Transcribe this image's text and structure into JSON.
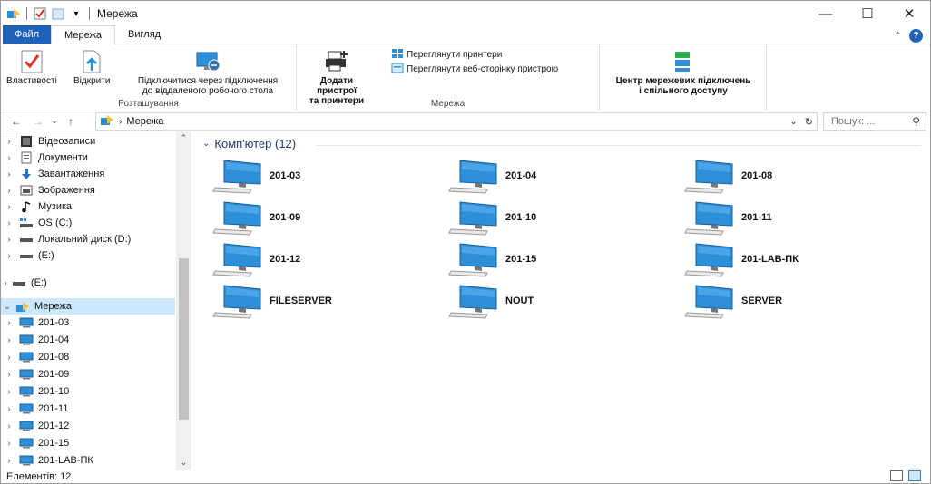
{
  "window": {
    "title": "Мережа",
    "controls": {
      "minimize": "—",
      "maximize": "☐",
      "close": "✕"
    }
  },
  "tabs": [
    "Файл",
    "Мережа",
    "Вигляд"
  ],
  "ribbon": {
    "location_group": {
      "label": "Розташування",
      "properties": "Властивості",
      "open": "Відкрити",
      "connect_remote_line1": "Підключитися через підключення",
      "connect_remote_line2": "до віддаленого робочого стола"
    },
    "network_group": {
      "label": "Мережа",
      "add_devices_line1": "Додати пристрої",
      "add_devices_line2": "та принтери",
      "view_printers": "Переглянути принтери",
      "view_device_page": "Переглянути веб-сторінку пристрою"
    },
    "network_center": {
      "line1": "Центр мережевих підключень",
      "line2": "і спільного доступу"
    }
  },
  "address": {
    "path": "Мережа",
    "search_placeholder": "Пошук: ..."
  },
  "nav": {
    "items": [
      {
        "label": "Відеозаписи",
        "icon": "video-icon"
      },
      {
        "label": "Документи",
        "icon": "documents-icon"
      },
      {
        "label": "Завантаження",
        "icon": "download-icon"
      },
      {
        "label": "Зображення",
        "icon": "pictures-icon"
      },
      {
        "label": "Музика",
        "icon": "music-icon"
      },
      {
        "label": "OS (C:)",
        "icon": "drive-os-icon"
      },
      {
        "label": "Локальний диск (D:)",
        "icon": "drive-icon"
      },
      {
        "label": "(E:)",
        "icon": "drive-icon"
      },
      {
        "label": "(E:)",
        "icon": "drive-icon"
      },
      {
        "label": "Мережа",
        "icon": "network-icon"
      },
      {
        "label": "201-03",
        "icon": "computer-icon"
      },
      {
        "label": "201-04",
        "icon": "computer-icon"
      },
      {
        "label": "201-08",
        "icon": "computer-icon"
      },
      {
        "label": "201-09",
        "icon": "computer-icon"
      },
      {
        "label": "201-10",
        "icon": "computer-icon"
      },
      {
        "label": "201-11",
        "icon": "computer-icon"
      },
      {
        "label": "201-12",
        "icon": "computer-icon"
      },
      {
        "label": "201-15",
        "icon": "computer-icon"
      },
      {
        "label": "201-LAB-ПК",
        "icon": "computer-icon"
      }
    ]
  },
  "content": {
    "group_title": "Комп'ютер (12)",
    "computers": [
      "201-03",
      "201-04",
      "201-08",
      "201-09",
      "201-10",
      "201-11",
      "201-12",
      "201-15",
      "201-LAB-ПК",
      "FILESERVER",
      "NOUT",
      "SERVER"
    ]
  },
  "status": {
    "items_count": "Елементів: 12"
  },
  "colors": {
    "accent": "#1e63b8",
    "selection": "#cce8ff",
    "monitor": "#2d8fd8"
  }
}
